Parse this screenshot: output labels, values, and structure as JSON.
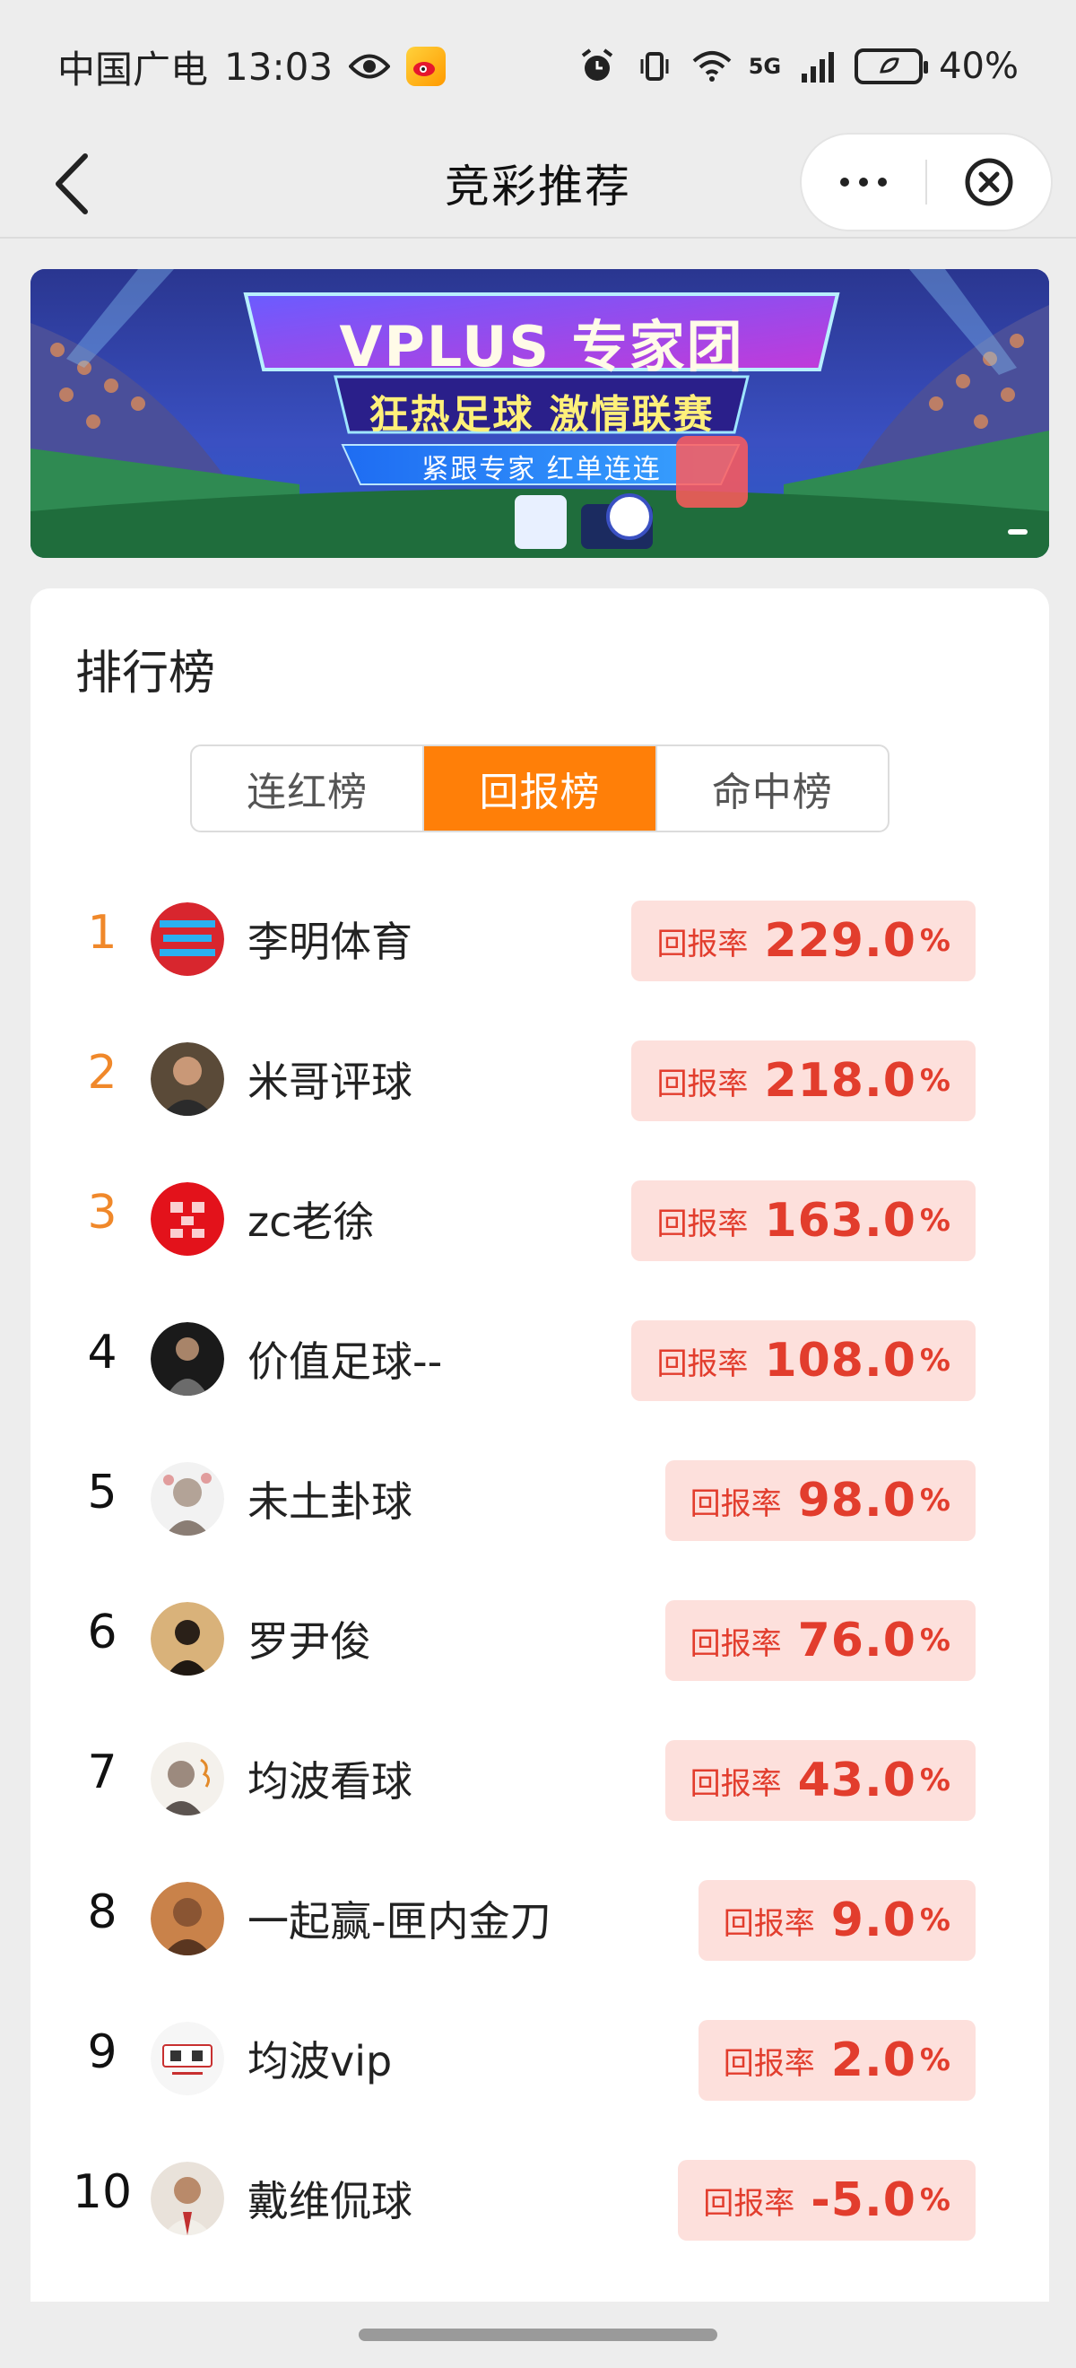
{
  "status_bar": {
    "carrier": "中国广电",
    "time": "13:03",
    "network_label": "5G",
    "battery": "40%"
  },
  "nav": {
    "title": "竞彩推荐",
    "icons": {
      "back": "back-arrow-icon",
      "more": "more-dots-icon",
      "close": "close-circle-icon"
    }
  },
  "banner": {
    "title": "VPLUS 专家团",
    "subtitle": "狂热足球 激情联赛",
    "tagline": "紧跟专家 红单连连"
  },
  "ranking": {
    "title": "排行榜",
    "tabs": [
      {
        "label": "连红榜",
        "active": false
      },
      {
        "label": "回报榜",
        "active": true
      },
      {
        "label": "命中榜",
        "active": false
      }
    ],
    "rate_label": "回报率",
    "percent_sign": "%",
    "colors": {
      "accent": "#ff7f08",
      "pill_bg": "#fde0dc",
      "pill_text": "#e23d2d",
      "top_rank": "#f0882a"
    },
    "rows": [
      {
        "rank": "1",
        "name": "李明体育",
        "rate": "229.0"
      },
      {
        "rank": "2",
        "name": "米哥评球",
        "rate": "218.0"
      },
      {
        "rank": "3",
        "name": "zc老徐",
        "rate": "163.0"
      },
      {
        "rank": "4",
        "name": "价值足球--",
        "rate": "108.0"
      },
      {
        "rank": "5",
        "name": "未土卦球",
        "rate": "98.0"
      },
      {
        "rank": "6",
        "name": "罗尹俊",
        "rate": "76.0"
      },
      {
        "rank": "7",
        "name": "均波看球",
        "rate": "43.0"
      },
      {
        "rank": "8",
        "name": "一起赢-匣内金刀",
        "rate": "9.0"
      },
      {
        "rank": "9",
        "name": "均波vip",
        "rate": "2.0"
      },
      {
        "rank": "10",
        "name": "戴维侃球",
        "rate": "-5.0"
      }
    ]
  }
}
